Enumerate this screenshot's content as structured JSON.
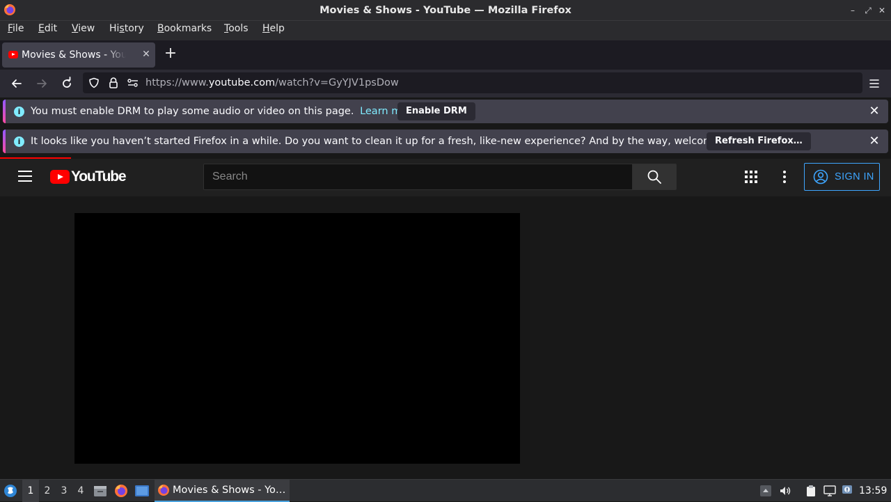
{
  "window": {
    "title": "Movies & Shows - YouTube — Mozilla Firefox",
    "controls": {
      "minimize": "–",
      "maximize": "⤢",
      "close": "✕"
    }
  },
  "menubar": {
    "items": [
      {
        "label": "File",
        "accel": "F",
        "rest": "ile"
      },
      {
        "label": "Edit",
        "accel": "E",
        "rest": "dit"
      },
      {
        "label": "View",
        "accel": "V",
        "rest": "iew"
      },
      {
        "label": "History",
        "pre": "Hi",
        "accel": "s",
        "rest": "tory"
      },
      {
        "label": "Bookmarks",
        "accel": "B",
        "rest": "ookmarks"
      },
      {
        "label": "Tools",
        "accel": "T",
        "rest": "ools"
      },
      {
        "label": "Help",
        "accel": "H",
        "rest": "elp"
      }
    ]
  },
  "tabs": [
    {
      "title": "Movies & Shows - YouTube",
      "active": true
    }
  ],
  "newtab_label": "+",
  "navbar": {
    "url_prefix": "https://www.",
    "url_host": "youtube.com",
    "url_path": "/watch?v=GyYJV1psDow"
  },
  "notifications": {
    "drm": {
      "message": "You must enable DRM to play some audio or video on this page.",
      "link": "Learn more",
      "button": "Enable DRM"
    },
    "refresh": {
      "message": "It looks like you haven’t started Firefox in a while. Do you want to clean it up for a fresh, like-new experience? And by the way, welcome back!",
      "button": "Refresh Firefox…"
    }
  },
  "youtube": {
    "logo_text": "YouTube",
    "search_placeholder": "Search",
    "signin_label": "SIGN IN"
  },
  "taskbar": {
    "workspaces": [
      "1",
      "2",
      "3",
      "4"
    ],
    "active_workspace": "1",
    "task_label": "Movies & Shows - Yo…",
    "clock": "13:59"
  },
  "colors": {
    "yt_red": "#ff0000",
    "link_blue": "#3ea6ff",
    "info_cyan": "#80ebff"
  }
}
